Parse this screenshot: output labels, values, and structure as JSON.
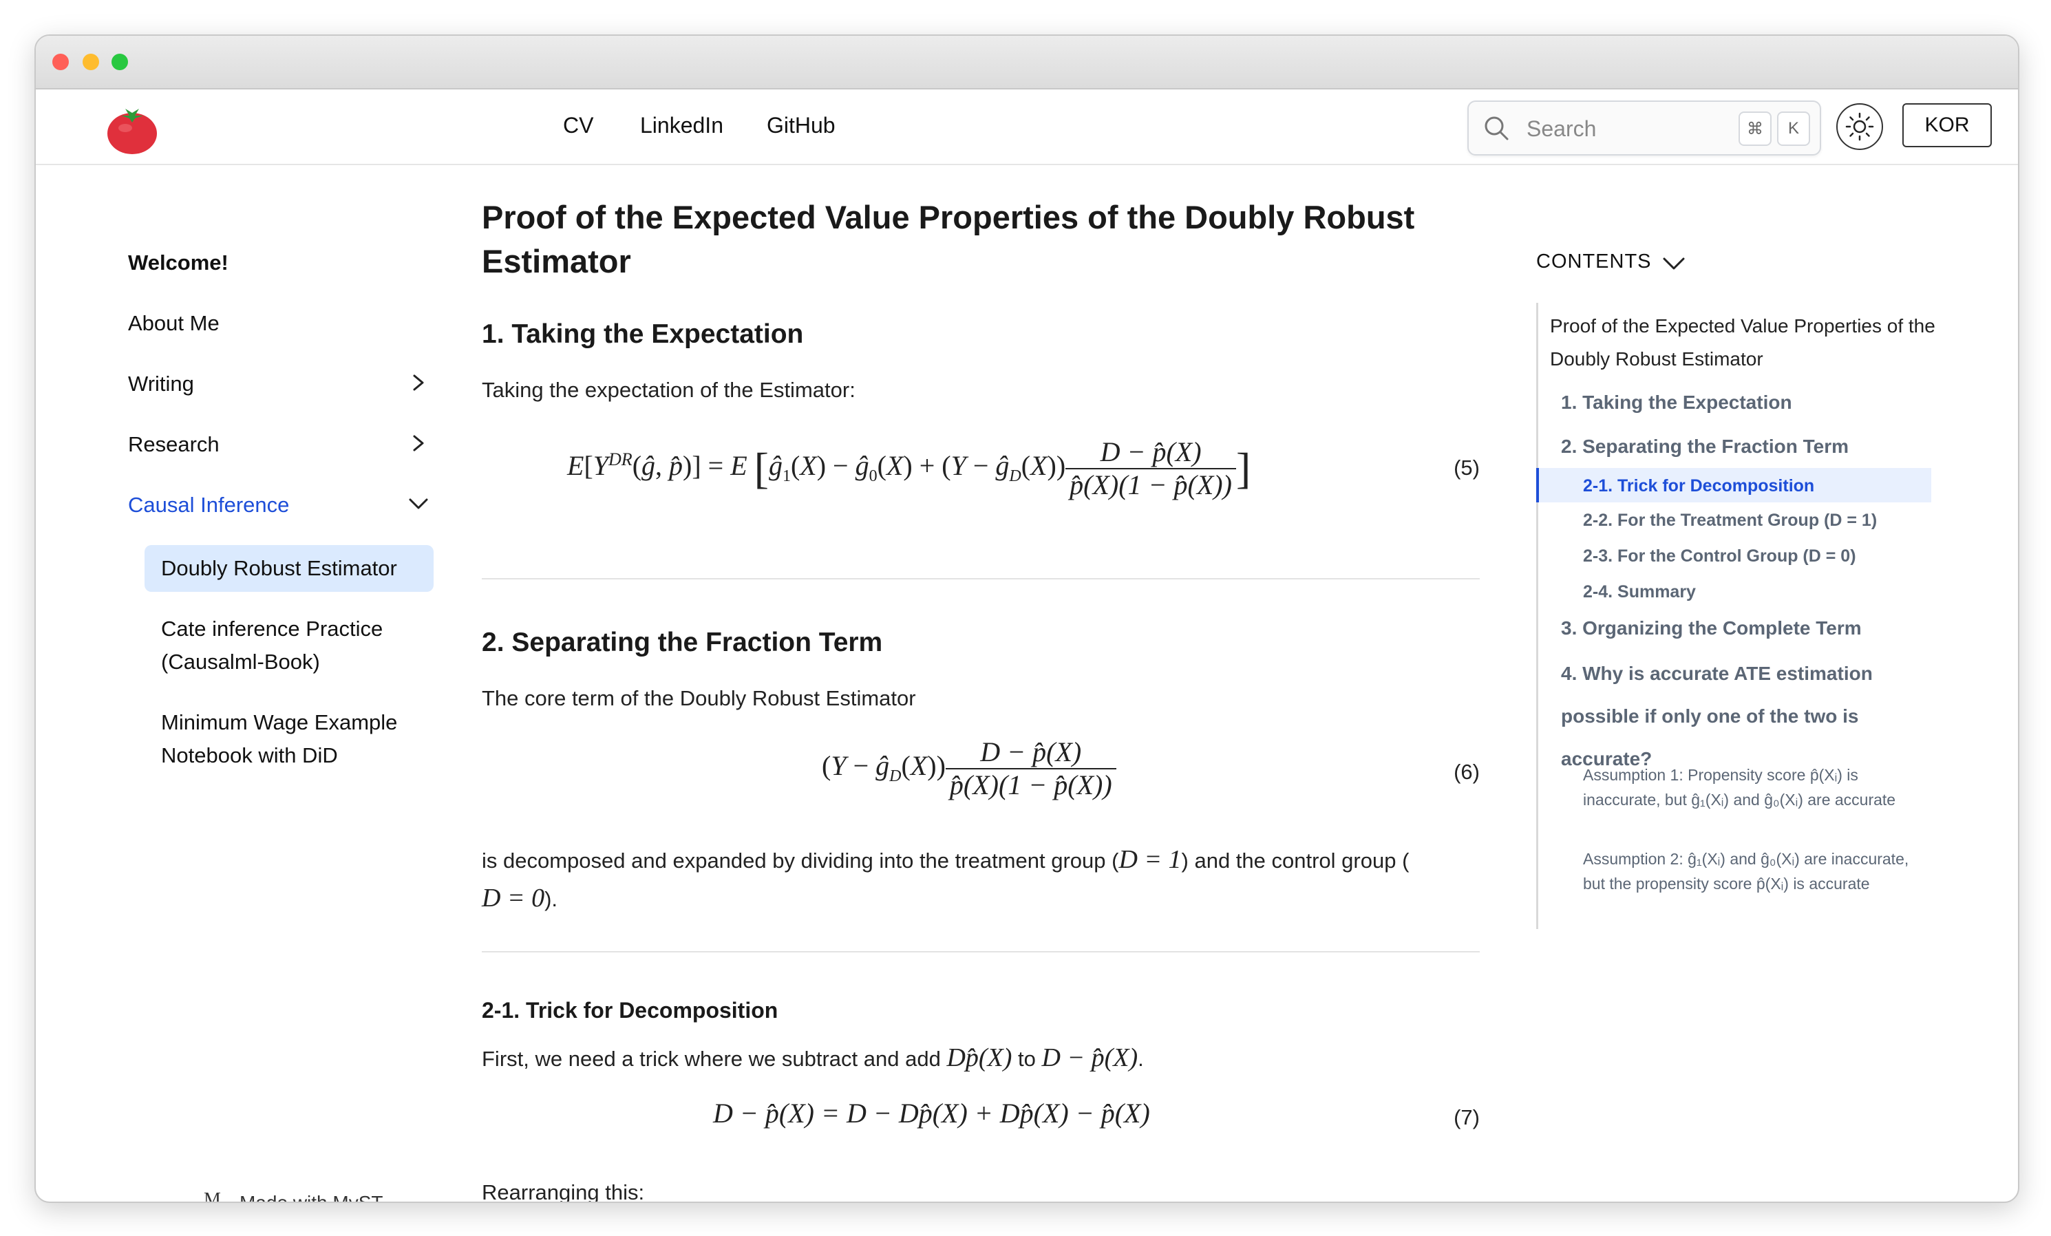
{
  "nav": {
    "links": [
      "CV",
      "LinkedIn",
      "GitHub"
    ],
    "search_placeholder": "Search",
    "kbd_cmd": "⌘",
    "kbd_k": "K",
    "lang_button": "KOR"
  },
  "sidebar": {
    "welcome": "Welcome!",
    "about": "About Me",
    "writing": "Writing",
    "research": "Research",
    "causal": "Causal Inference",
    "sub": [
      "Doubly Robust Estimator",
      "Cate inference Practice (Causalml-Book)",
      "Minimum Wage Example Notebook with DiD"
    ],
    "made_with": "Made with MyST"
  },
  "article": {
    "title": "Proof of the Expected Value Properties of the Doubly Robust Estimator",
    "s1_heading": "1. Taking the Expectation",
    "s1_text": "Taking the expectation of the Estimator:",
    "eq5": "(5)",
    "s2_heading": "2. Separating the Fraction Term",
    "s2_text": "The core term of the Doubly Robust Estimator",
    "eq6": "(6)",
    "s2_text2_a": "is decomposed and expanded by dividing into the treatment group (",
    "s2_text2_b": ") and the control group (",
    "s2_text2_c": ").",
    "s21_heading": "2-1. Trick for Decomposition",
    "s21_text_a": "First, we need a trick where we subtract and add ",
    "s21_text_b": " to ",
    "s21_text_c": ".",
    "eq7": "(7)",
    "rearranging": "Rearranging this:"
  },
  "toc": {
    "heading": "CONTENTS",
    "title": "Proof of the Expected Value Properties of the Doubly Robust Estimator",
    "s1": "1. Taking the Expectation",
    "s2": "2. Separating the Fraction Term",
    "s21": "2-1. Trick for Decomposition",
    "s22": "2-2. For the Treatment Group (D = 1)",
    "s23": "2-3. For the Control Group (D = 0)",
    "s24": "2-4. Summary",
    "s3": "3. Organizing the Complete Term",
    "s4": "4. Why is accurate ATE estimation possible if only one of the two is accurate?",
    "a1": "Assumption 1: Propensity score p̂(Xᵢ) is inaccurate, but ĝ₁(Xᵢ) and ĝ₀(Xᵢ) are accurate",
    "a2": "Assumption 2: ĝ₁(Xᵢ) and ĝ₀(Xᵢ) are inaccurate, but the propensity score p̂(Xᵢ) is accurate"
  },
  "colors": {
    "accent": "#1d4ed8",
    "active_bg": "#dbeafe"
  }
}
